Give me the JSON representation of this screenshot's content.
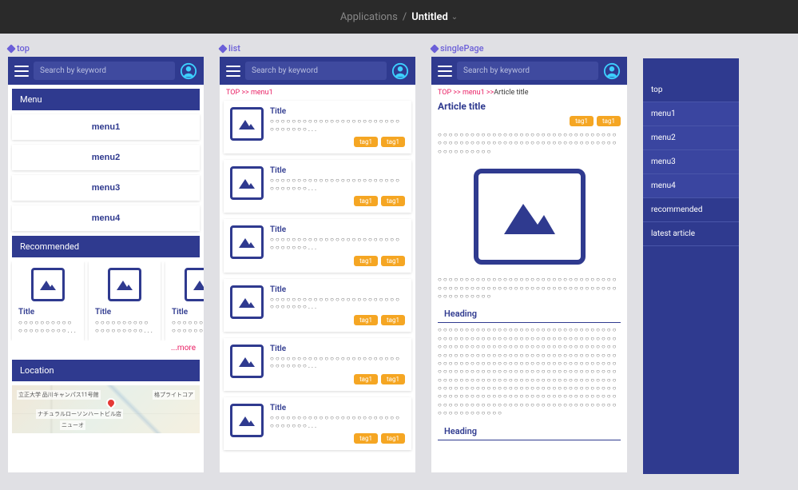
{
  "header": {
    "crumb_root": "Applications",
    "crumb_sep": "/",
    "crumb_current": "Untitled"
  },
  "artboards": {
    "top": {
      "label": "top",
      "search_placeholder": "Search by keyword",
      "menu_header": "Menu",
      "menu_items": [
        "menu1",
        "menu2",
        "menu3",
        "menu4"
      ],
      "rec_header": "Recommended",
      "rec_cards": [
        {
          "title": "Title",
          "body": "○○○○○○○○○○○○○○○○○○○..."
        },
        {
          "title": "Title",
          "body": "○○○○○○○○○○○○○○○○○○○..."
        },
        {
          "title": "Title",
          "body": "○○○○○○○○○○○○○○○○○○○..."
        }
      ],
      "more_label": "...more",
      "location_header": "Location",
      "map_labels": [
        "立正大学 品川キャンパス11号館",
        "ナチュラルローソンハートビル店",
        "格プライトコア",
        "ニューオ"
      ]
    },
    "list": {
      "label": "list",
      "search_placeholder": "Search by keyword",
      "breadcrumb": "TOP >> menu1",
      "cards": [
        {
          "title": "Title",
          "body": "○○○○○○○○○○○○○○○○○○○○○○○○○○○○○○○...",
          "tags": [
            "tag1",
            "tag1"
          ]
        },
        {
          "title": "Title",
          "body": "○○○○○○○○○○○○○○○○○○○○○○○○○○○○○○○...",
          "tags": [
            "tag1",
            "tag1"
          ]
        },
        {
          "title": "Title",
          "body": "○○○○○○○○○○○○○○○○○○○○○○○○○○○○○○○...",
          "tags": [
            "tag1",
            "tag1"
          ]
        },
        {
          "title": "Title",
          "body": "○○○○○○○○○○○○○○○○○○○○○○○○○○○○○○○...",
          "tags": [
            "tag1",
            "tag1"
          ]
        },
        {
          "title": "Title",
          "body": "○○○○○○○○○○○○○○○○○○○○○○○○○○○○○○○...",
          "tags": [
            "tag1",
            "tag1"
          ]
        },
        {
          "title": "Title",
          "body": "○○○○○○○○○○○○○○○○○○○○○○○○○○○○○○○...",
          "tags": [
            "tag1",
            "tag1"
          ]
        }
      ]
    },
    "singlePage": {
      "label": "singlePage",
      "search_placeholder": "Search by keyword",
      "breadcrumb_prefix": "TOP >> menu1 >>",
      "breadcrumb_current": "Article title",
      "article_title": "Article title",
      "tags": [
        "tag1",
        "tag1"
      ],
      "intro_text": "○○○○○○○○○○○○○○○○○○○○○○○○○○○○○○○○○○○○○○○○○○○○○○○○○○○○○○○○○○○○○○○○○○○○○○○○○○○○",
      "after_img_text": "○○○○○○○○○○○○○○○○○○○○○○○○○○○○○○○○○○○○○○○○○○○○○○○○○○○○○○○○○○○○○○○○○○○○○○○○○○○○",
      "heading1": "Heading",
      "body1": "○○○○○○○○○○○○○○○○○○○○○○○○○○○○○○○○○○○○○○○○○○○○○○○○○○○○○○○○○○○○○○○○○○○○○○○○○○○○○○○○○○○○○○○○○○○○○○○○○○○○○○○○○○○○○○○○○○○○○○○○○○○○○○○○○○○○○○○○○○○○○○○○○○○○○○○○○○○○○○○○○○○○○○○○○○○○○○○○○○○○○○○○○○○○○○○○○○○○○○○○○○○○○○○○○○○○○○○○○○○○○○○○○○○○○○○○○○○○○○○○○○○○○○○○○○○○○○○○○○○○○○○○○○○○○○○○○○○○○○○○○○○○○○○○○○○○○○○○○○○○○○○○○○○○○○○○○○○○○○○○○○○○○○○○○○○○○○○○○○○○○○",
      "heading2": "Heading"
    }
  },
  "sidebar": {
    "items": [
      "top",
      "menu1",
      "menu2",
      "menu3",
      "menu4",
      "recommended",
      "latest article"
    ]
  },
  "colors": {
    "brand": "#2f3a8f",
    "accent_pink": "#e91e63",
    "tag_bg": "#f5a623",
    "canvas_bg": "#e0e0e4"
  }
}
